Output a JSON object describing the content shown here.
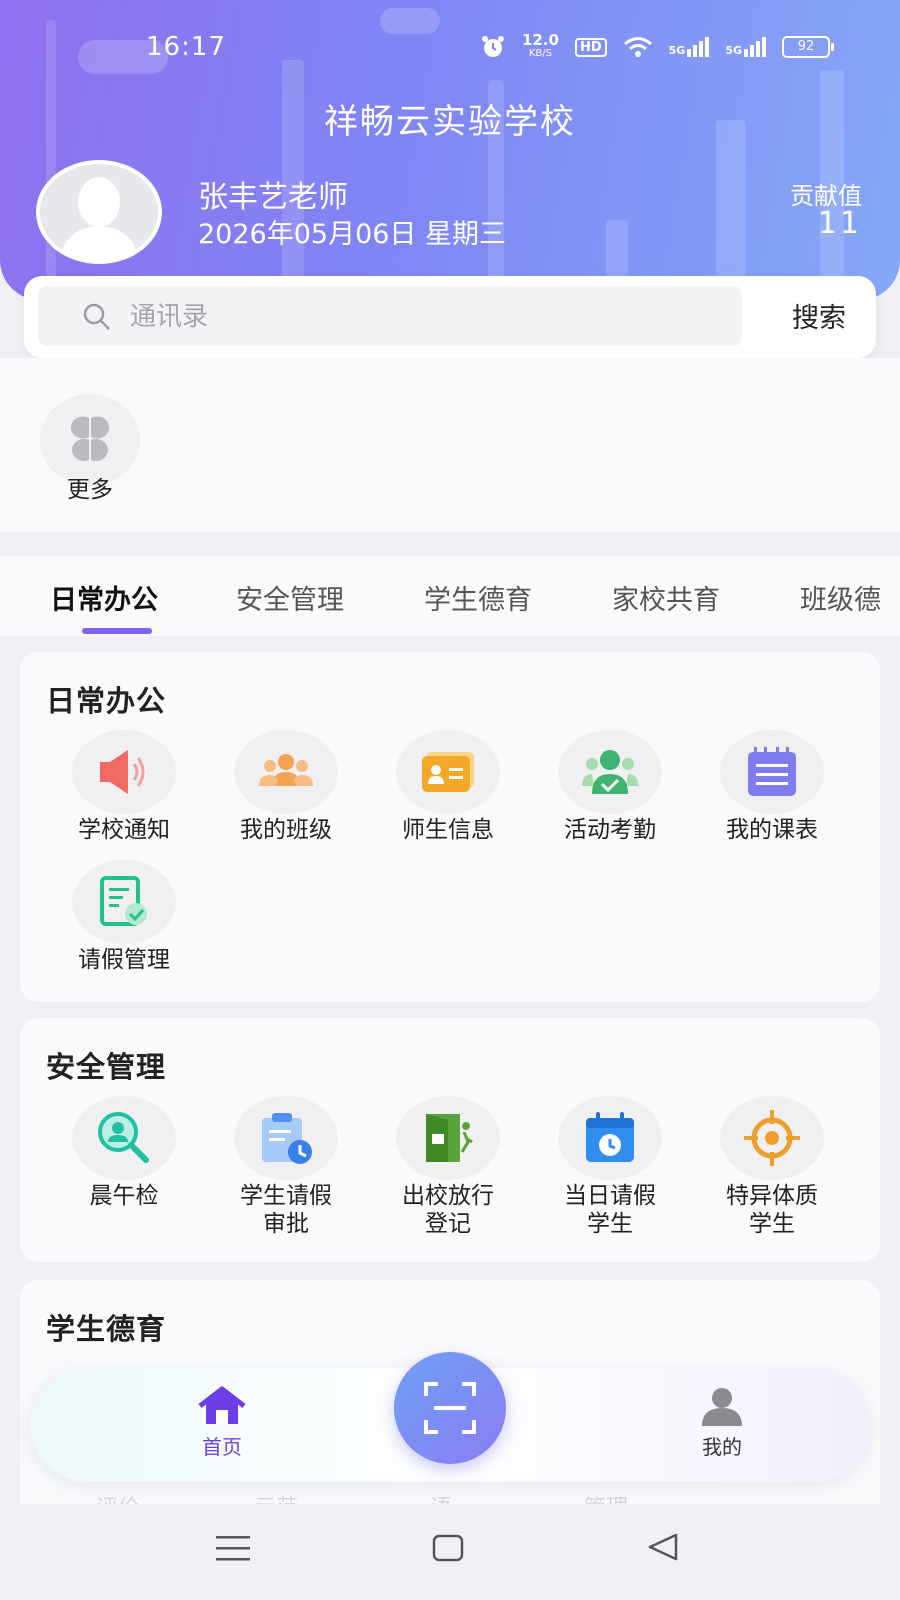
{
  "status_bar": {
    "time": "16:17",
    "net_speed": "12.0",
    "net_unit": "KB/S",
    "hd": "HD",
    "signal1": "5G",
    "signal2": "5G",
    "battery": "92"
  },
  "header": {
    "school_name": "祥畅云实验学校",
    "user_name": "张丰艺老师",
    "date": "2026年05月06日 星期三",
    "contribution_label": "贡献值",
    "contribution_value": "11"
  },
  "search": {
    "placeholder": "通讯录",
    "button": "搜索"
  },
  "shortcuts": [
    {
      "label": "更多",
      "icon": "four-petal-grid-icon"
    }
  ],
  "tabs": [
    {
      "label": "日常办公",
      "active": true
    },
    {
      "label": "安全管理",
      "active": false
    },
    {
      "label": "学生德育",
      "active": false
    },
    {
      "label": "家校共育",
      "active": false
    },
    {
      "label": "班级德",
      "active": false
    }
  ],
  "sections": [
    {
      "title": "日常办公",
      "items": [
        {
          "label": "学校通知",
          "icon": "megaphone-icon"
        },
        {
          "label": "我的班级",
          "icon": "group-icon"
        },
        {
          "label": "师生信息",
          "icon": "id-card-icon"
        },
        {
          "label": "活动考勤",
          "icon": "attendance-icon"
        },
        {
          "label": "我的课表",
          "icon": "schedule-icon"
        },
        {
          "label": "请假管理",
          "icon": "leave-doc-icon"
        }
      ]
    },
    {
      "title": "安全管理",
      "items": [
        {
          "label": "晨午检",
          "icon": "magnifier-person-icon"
        },
        {
          "label": "学生请假",
          "label2": "审批",
          "icon": "clipboard-clock-icon"
        },
        {
          "label": "出校放行",
          "label2": "登记",
          "icon": "exit-door-icon"
        },
        {
          "label": "当日请假",
          "label2": "学生",
          "icon": "calendar-clock-icon"
        },
        {
          "label": "特异体质",
          "label2": "学生",
          "icon": "target-icon"
        }
      ]
    },
    {
      "title": "学生德育",
      "items_faded": [
        "评价",
        "示范",
        "语",
        "管理"
      ]
    }
  ],
  "bottom_nav": [
    {
      "label": "首页",
      "icon": "home-icon",
      "active": true
    },
    {
      "label": "",
      "icon": "scan-icon"
    },
    {
      "label": "我的",
      "icon": "user-icon",
      "active": false
    }
  ],
  "colors": {
    "accent": "#8062f0",
    "header_start": "#9070f0",
    "header_end": "#86a8f7"
  }
}
